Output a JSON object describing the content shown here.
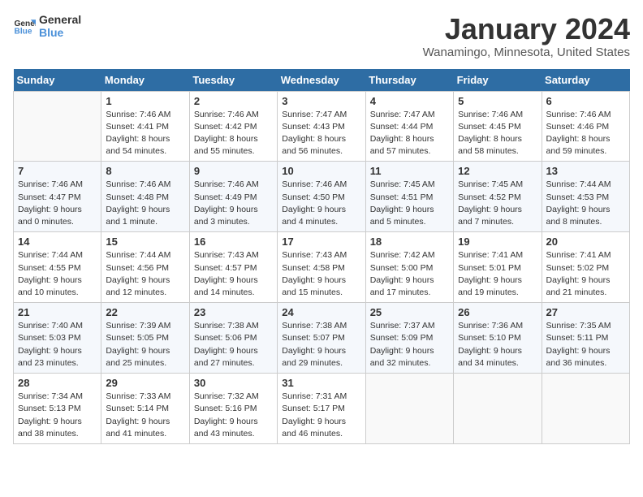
{
  "logo": {
    "line1": "General",
    "line2": "Blue"
  },
  "title": "January 2024",
  "subtitle": "Wanamingo, Minnesota, United States",
  "weekdays": [
    "Sunday",
    "Monday",
    "Tuesday",
    "Wednesday",
    "Thursday",
    "Friday",
    "Saturday"
  ],
  "weeks": [
    [
      {
        "day": "",
        "info": ""
      },
      {
        "day": "1",
        "info": "Sunrise: 7:46 AM\nSunset: 4:41 PM\nDaylight: 8 hours\nand 54 minutes."
      },
      {
        "day": "2",
        "info": "Sunrise: 7:46 AM\nSunset: 4:42 PM\nDaylight: 8 hours\nand 55 minutes."
      },
      {
        "day": "3",
        "info": "Sunrise: 7:47 AM\nSunset: 4:43 PM\nDaylight: 8 hours\nand 56 minutes."
      },
      {
        "day": "4",
        "info": "Sunrise: 7:47 AM\nSunset: 4:44 PM\nDaylight: 8 hours\nand 57 minutes."
      },
      {
        "day": "5",
        "info": "Sunrise: 7:46 AM\nSunset: 4:45 PM\nDaylight: 8 hours\nand 58 minutes."
      },
      {
        "day": "6",
        "info": "Sunrise: 7:46 AM\nSunset: 4:46 PM\nDaylight: 8 hours\nand 59 minutes."
      }
    ],
    [
      {
        "day": "7",
        "info": "Sunrise: 7:46 AM\nSunset: 4:47 PM\nDaylight: 9 hours\nand 0 minutes."
      },
      {
        "day": "8",
        "info": "Sunrise: 7:46 AM\nSunset: 4:48 PM\nDaylight: 9 hours\nand 1 minute."
      },
      {
        "day": "9",
        "info": "Sunrise: 7:46 AM\nSunset: 4:49 PM\nDaylight: 9 hours\nand 3 minutes."
      },
      {
        "day": "10",
        "info": "Sunrise: 7:46 AM\nSunset: 4:50 PM\nDaylight: 9 hours\nand 4 minutes."
      },
      {
        "day": "11",
        "info": "Sunrise: 7:45 AM\nSunset: 4:51 PM\nDaylight: 9 hours\nand 5 minutes."
      },
      {
        "day": "12",
        "info": "Sunrise: 7:45 AM\nSunset: 4:52 PM\nDaylight: 9 hours\nand 7 minutes."
      },
      {
        "day": "13",
        "info": "Sunrise: 7:44 AM\nSunset: 4:53 PM\nDaylight: 9 hours\nand 8 minutes."
      }
    ],
    [
      {
        "day": "14",
        "info": "Sunrise: 7:44 AM\nSunset: 4:55 PM\nDaylight: 9 hours\nand 10 minutes."
      },
      {
        "day": "15",
        "info": "Sunrise: 7:44 AM\nSunset: 4:56 PM\nDaylight: 9 hours\nand 12 minutes."
      },
      {
        "day": "16",
        "info": "Sunrise: 7:43 AM\nSunset: 4:57 PM\nDaylight: 9 hours\nand 14 minutes."
      },
      {
        "day": "17",
        "info": "Sunrise: 7:43 AM\nSunset: 4:58 PM\nDaylight: 9 hours\nand 15 minutes."
      },
      {
        "day": "18",
        "info": "Sunrise: 7:42 AM\nSunset: 5:00 PM\nDaylight: 9 hours\nand 17 minutes."
      },
      {
        "day": "19",
        "info": "Sunrise: 7:41 AM\nSunset: 5:01 PM\nDaylight: 9 hours\nand 19 minutes."
      },
      {
        "day": "20",
        "info": "Sunrise: 7:41 AM\nSunset: 5:02 PM\nDaylight: 9 hours\nand 21 minutes."
      }
    ],
    [
      {
        "day": "21",
        "info": "Sunrise: 7:40 AM\nSunset: 5:03 PM\nDaylight: 9 hours\nand 23 minutes."
      },
      {
        "day": "22",
        "info": "Sunrise: 7:39 AM\nSunset: 5:05 PM\nDaylight: 9 hours\nand 25 minutes."
      },
      {
        "day": "23",
        "info": "Sunrise: 7:38 AM\nSunset: 5:06 PM\nDaylight: 9 hours\nand 27 minutes."
      },
      {
        "day": "24",
        "info": "Sunrise: 7:38 AM\nSunset: 5:07 PM\nDaylight: 9 hours\nand 29 minutes."
      },
      {
        "day": "25",
        "info": "Sunrise: 7:37 AM\nSunset: 5:09 PM\nDaylight: 9 hours\nand 32 minutes."
      },
      {
        "day": "26",
        "info": "Sunrise: 7:36 AM\nSunset: 5:10 PM\nDaylight: 9 hours\nand 34 minutes."
      },
      {
        "day": "27",
        "info": "Sunrise: 7:35 AM\nSunset: 5:11 PM\nDaylight: 9 hours\nand 36 minutes."
      }
    ],
    [
      {
        "day": "28",
        "info": "Sunrise: 7:34 AM\nSunset: 5:13 PM\nDaylight: 9 hours\nand 38 minutes."
      },
      {
        "day": "29",
        "info": "Sunrise: 7:33 AM\nSunset: 5:14 PM\nDaylight: 9 hours\nand 41 minutes."
      },
      {
        "day": "30",
        "info": "Sunrise: 7:32 AM\nSunset: 5:16 PM\nDaylight: 9 hours\nand 43 minutes."
      },
      {
        "day": "31",
        "info": "Sunrise: 7:31 AM\nSunset: 5:17 PM\nDaylight: 9 hours\nand 46 minutes."
      },
      {
        "day": "",
        "info": ""
      },
      {
        "day": "",
        "info": ""
      },
      {
        "day": "",
        "info": ""
      }
    ]
  ]
}
